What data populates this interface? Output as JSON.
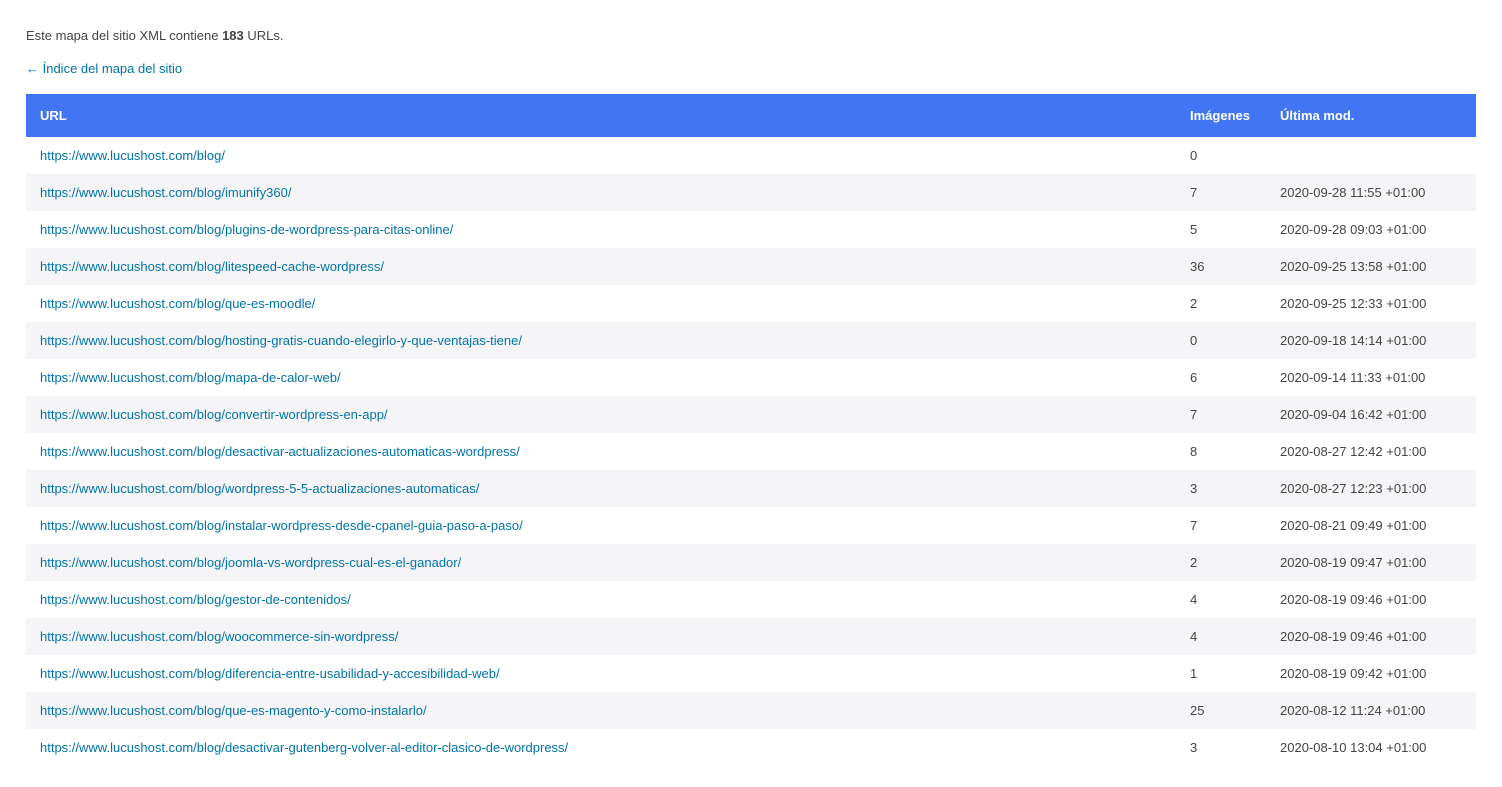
{
  "intro": {
    "prefix": "Este mapa del sitio XML contiene ",
    "count": "183",
    "suffix": " URLs."
  },
  "back_link": "← Índice del mapa del sitio",
  "headers": {
    "url": "URL",
    "images": "Imágenes",
    "mod": "Última mod."
  },
  "rows": [
    {
      "url": "https://www.lucushost.com/blog/",
      "images": "0",
      "mod": ""
    },
    {
      "url": "https://www.lucushost.com/blog/imunify360/",
      "images": "7",
      "mod": "2020-09-28 11:55 +01:00"
    },
    {
      "url": "https://www.lucushost.com/blog/plugins-de-wordpress-para-citas-online/",
      "images": "5",
      "mod": "2020-09-28 09:03 +01:00"
    },
    {
      "url": "https://www.lucushost.com/blog/litespeed-cache-wordpress/",
      "images": "36",
      "mod": "2020-09-25 13:58 +01:00"
    },
    {
      "url": "https://www.lucushost.com/blog/que-es-moodle/",
      "images": "2",
      "mod": "2020-09-25 12:33 +01:00"
    },
    {
      "url": "https://www.lucushost.com/blog/hosting-gratis-cuando-elegirlo-y-que-ventajas-tiene/",
      "images": "0",
      "mod": "2020-09-18 14:14 +01:00"
    },
    {
      "url": "https://www.lucushost.com/blog/mapa-de-calor-web/",
      "images": "6",
      "mod": "2020-09-14 11:33 +01:00"
    },
    {
      "url": "https://www.lucushost.com/blog/convertir-wordpress-en-app/",
      "images": "7",
      "mod": "2020-09-04 16:42 +01:00"
    },
    {
      "url": "https://www.lucushost.com/blog/desactivar-actualizaciones-automaticas-wordpress/",
      "images": "8",
      "mod": "2020-08-27 12:42 +01:00"
    },
    {
      "url": "https://www.lucushost.com/blog/wordpress-5-5-actualizaciones-automaticas/",
      "images": "3",
      "mod": "2020-08-27 12:23 +01:00"
    },
    {
      "url": "https://www.lucushost.com/blog/instalar-wordpress-desde-cpanel-guia-paso-a-paso/",
      "images": "7",
      "mod": "2020-08-21 09:49 +01:00"
    },
    {
      "url": "https://www.lucushost.com/blog/joomla-vs-wordpress-cual-es-el-ganador/",
      "images": "2",
      "mod": "2020-08-19 09:47 +01:00"
    },
    {
      "url": "https://www.lucushost.com/blog/gestor-de-contenidos/",
      "images": "4",
      "mod": "2020-08-19 09:46 +01:00"
    },
    {
      "url": "https://www.lucushost.com/blog/woocommerce-sin-wordpress/",
      "images": "4",
      "mod": "2020-08-19 09:46 +01:00"
    },
    {
      "url": "https://www.lucushost.com/blog/diferencia-entre-usabilidad-y-accesibilidad-web/",
      "images": "1",
      "mod": "2020-08-19 09:42 +01:00"
    },
    {
      "url": "https://www.lucushost.com/blog/que-es-magento-y-como-instalarlo/",
      "images": "25",
      "mod": "2020-08-12 11:24 +01:00"
    },
    {
      "url": "https://www.lucushost.com/blog/desactivar-gutenberg-volver-al-editor-clasico-de-wordpress/",
      "images": "3",
      "mod": "2020-08-10 13:04 +01:00"
    }
  ]
}
